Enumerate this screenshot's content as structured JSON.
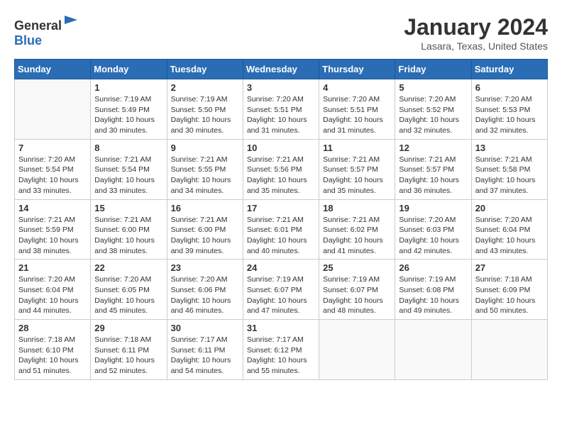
{
  "header": {
    "logo_general": "General",
    "logo_blue": "Blue",
    "title": "January 2024",
    "subtitle": "Lasara, Texas, United States"
  },
  "calendar": {
    "days_of_week": [
      "Sunday",
      "Monday",
      "Tuesday",
      "Wednesday",
      "Thursday",
      "Friday",
      "Saturday"
    ],
    "weeks": [
      [
        {
          "day": "",
          "info": ""
        },
        {
          "day": "1",
          "info": "Sunrise: 7:19 AM\nSunset: 5:49 PM\nDaylight: 10 hours\nand 30 minutes."
        },
        {
          "day": "2",
          "info": "Sunrise: 7:19 AM\nSunset: 5:50 PM\nDaylight: 10 hours\nand 30 minutes."
        },
        {
          "day": "3",
          "info": "Sunrise: 7:20 AM\nSunset: 5:51 PM\nDaylight: 10 hours\nand 31 minutes."
        },
        {
          "day": "4",
          "info": "Sunrise: 7:20 AM\nSunset: 5:51 PM\nDaylight: 10 hours\nand 31 minutes."
        },
        {
          "day": "5",
          "info": "Sunrise: 7:20 AM\nSunset: 5:52 PM\nDaylight: 10 hours\nand 32 minutes."
        },
        {
          "day": "6",
          "info": "Sunrise: 7:20 AM\nSunset: 5:53 PM\nDaylight: 10 hours\nand 32 minutes."
        }
      ],
      [
        {
          "day": "7",
          "info": "Sunrise: 7:20 AM\nSunset: 5:54 PM\nDaylight: 10 hours\nand 33 minutes."
        },
        {
          "day": "8",
          "info": "Sunrise: 7:21 AM\nSunset: 5:54 PM\nDaylight: 10 hours\nand 33 minutes."
        },
        {
          "day": "9",
          "info": "Sunrise: 7:21 AM\nSunset: 5:55 PM\nDaylight: 10 hours\nand 34 minutes."
        },
        {
          "day": "10",
          "info": "Sunrise: 7:21 AM\nSunset: 5:56 PM\nDaylight: 10 hours\nand 35 minutes."
        },
        {
          "day": "11",
          "info": "Sunrise: 7:21 AM\nSunset: 5:57 PM\nDaylight: 10 hours\nand 35 minutes."
        },
        {
          "day": "12",
          "info": "Sunrise: 7:21 AM\nSunset: 5:57 PM\nDaylight: 10 hours\nand 36 minutes."
        },
        {
          "day": "13",
          "info": "Sunrise: 7:21 AM\nSunset: 5:58 PM\nDaylight: 10 hours\nand 37 minutes."
        }
      ],
      [
        {
          "day": "14",
          "info": "Sunrise: 7:21 AM\nSunset: 5:59 PM\nDaylight: 10 hours\nand 38 minutes."
        },
        {
          "day": "15",
          "info": "Sunrise: 7:21 AM\nSunset: 6:00 PM\nDaylight: 10 hours\nand 38 minutes."
        },
        {
          "day": "16",
          "info": "Sunrise: 7:21 AM\nSunset: 6:00 PM\nDaylight: 10 hours\nand 39 minutes."
        },
        {
          "day": "17",
          "info": "Sunrise: 7:21 AM\nSunset: 6:01 PM\nDaylight: 10 hours\nand 40 minutes."
        },
        {
          "day": "18",
          "info": "Sunrise: 7:21 AM\nSunset: 6:02 PM\nDaylight: 10 hours\nand 41 minutes."
        },
        {
          "day": "19",
          "info": "Sunrise: 7:20 AM\nSunset: 6:03 PM\nDaylight: 10 hours\nand 42 minutes."
        },
        {
          "day": "20",
          "info": "Sunrise: 7:20 AM\nSunset: 6:04 PM\nDaylight: 10 hours\nand 43 minutes."
        }
      ],
      [
        {
          "day": "21",
          "info": "Sunrise: 7:20 AM\nSunset: 6:04 PM\nDaylight: 10 hours\nand 44 minutes."
        },
        {
          "day": "22",
          "info": "Sunrise: 7:20 AM\nSunset: 6:05 PM\nDaylight: 10 hours\nand 45 minutes."
        },
        {
          "day": "23",
          "info": "Sunrise: 7:20 AM\nSunset: 6:06 PM\nDaylight: 10 hours\nand 46 minutes."
        },
        {
          "day": "24",
          "info": "Sunrise: 7:19 AM\nSunset: 6:07 PM\nDaylight: 10 hours\nand 47 minutes."
        },
        {
          "day": "25",
          "info": "Sunrise: 7:19 AM\nSunset: 6:07 PM\nDaylight: 10 hours\nand 48 minutes."
        },
        {
          "day": "26",
          "info": "Sunrise: 7:19 AM\nSunset: 6:08 PM\nDaylight: 10 hours\nand 49 minutes."
        },
        {
          "day": "27",
          "info": "Sunrise: 7:18 AM\nSunset: 6:09 PM\nDaylight: 10 hours\nand 50 minutes."
        }
      ],
      [
        {
          "day": "28",
          "info": "Sunrise: 7:18 AM\nSunset: 6:10 PM\nDaylight: 10 hours\nand 51 minutes."
        },
        {
          "day": "29",
          "info": "Sunrise: 7:18 AM\nSunset: 6:11 PM\nDaylight: 10 hours\nand 52 minutes."
        },
        {
          "day": "30",
          "info": "Sunrise: 7:17 AM\nSunset: 6:11 PM\nDaylight: 10 hours\nand 54 minutes."
        },
        {
          "day": "31",
          "info": "Sunrise: 7:17 AM\nSunset: 6:12 PM\nDaylight: 10 hours\nand 55 minutes."
        },
        {
          "day": "",
          "info": ""
        },
        {
          "day": "",
          "info": ""
        },
        {
          "day": "",
          "info": ""
        }
      ]
    ]
  }
}
